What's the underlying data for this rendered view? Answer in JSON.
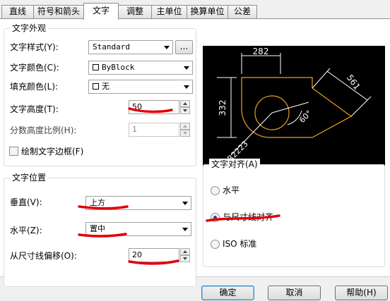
{
  "tabs": [
    "直线",
    "符号和箭头",
    "文字",
    "调整",
    "主单位",
    "换算单位",
    "公差"
  ],
  "active_tab": "文字",
  "text_appearance": {
    "title": "文字外观",
    "style_label": "文字样式(Y):",
    "style_value": "Standard",
    "style_button": "...",
    "color_label": "文字颜色(C):",
    "color_value": "ByBlock",
    "fill_label": "填充颜色(L):",
    "fill_value": "无",
    "height_label": "文字高度(T):",
    "height_value": "50",
    "fraction_label": "分数高度比例(H):",
    "fraction_value": "1",
    "frame_label": "绘制文字边框(F)"
  },
  "text_placement": {
    "title": "文字位置",
    "vertical_label": "垂直(V):",
    "vertical_value": "上方",
    "horizontal_label": "水平(Z):",
    "horizontal_value": "置中",
    "offset_label": "从尺寸线偏移(O):",
    "offset_value": "20"
  },
  "text_alignment": {
    "title": "文字对齐(A)",
    "options": [
      "水平",
      "与尺寸线对齐",
      "ISO 标准"
    ],
    "selected": "与尺寸线对齐"
  },
  "preview": {
    "dim_top": "282",
    "dim_left": "332",
    "dim_right": "561",
    "angle": "60°",
    "radius": "R2223"
  },
  "buttons": {
    "ok": "确定",
    "cancel": "取消",
    "help": "帮助(H)"
  },
  "colors": {
    "annotation_red": "#e0000a",
    "preview_bg": "#000000",
    "preview_orange": "#e8a020"
  }
}
